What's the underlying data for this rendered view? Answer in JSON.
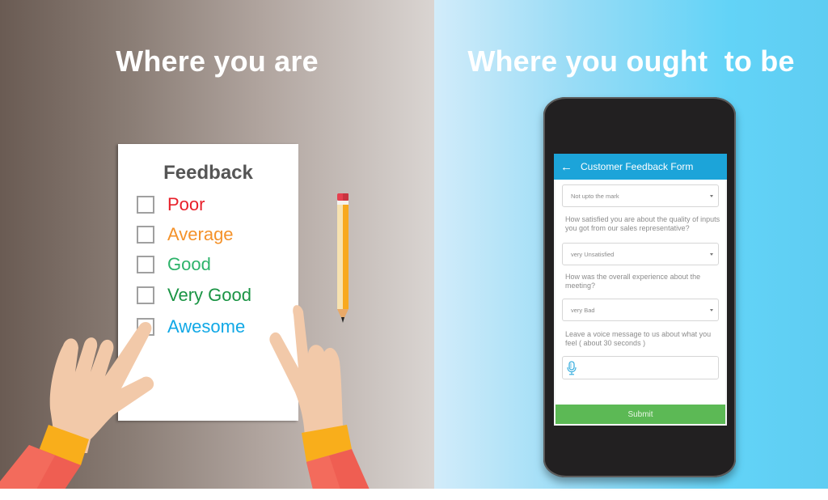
{
  "left": {
    "heading": "Where you are",
    "paper": {
      "title": "Feedback",
      "options": [
        {
          "label": "Poor",
          "color": "#e8202a",
          "checked": false
        },
        {
          "label": "Average",
          "color": "#f4922a",
          "checked": false
        },
        {
          "label": "Good",
          "color": "#2db36a",
          "checked": false
        },
        {
          "label": "Very Good",
          "color": "#1a9444",
          "checked": false
        },
        {
          "label": "Awesome",
          "color": "#10a8e6",
          "checked": false
        }
      ]
    }
  },
  "right": {
    "heading": "Where you ought  to be",
    "app": {
      "back_icon": "←",
      "title": "Customer Feedback Form",
      "fields": [
        {
          "type": "select",
          "value": "Not upto the mark"
        },
        {
          "type": "question",
          "text": "How satisfied you are about the quality of inputs you got from our sales representative?"
        },
        {
          "type": "select",
          "value": "very Unsatisfied"
        },
        {
          "type": "question",
          "text": "How was the overall experience about the meeting?"
        },
        {
          "type": "select",
          "value": "very Bad"
        },
        {
          "type": "question",
          "text": "Leave a voice message to us about what you feel ( about 30 seconds )"
        }
      ],
      "voice_icon": "microphone-icon",
      "submit_label": "Submit"
    }
  },
  "colors": {
    "appbar": "#1ca4d9",
    "submit": "#5cb955",
    "mic": "#3fb1e0"
  }
}
